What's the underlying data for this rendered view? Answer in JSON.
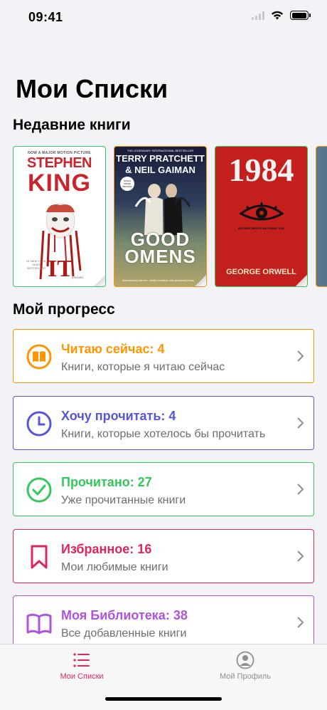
{
  "status_bar": {
    "time": "09:41"
  },
  "page_title": "Мои Списки",
  "recent_section_title": "Недавние книги",
  "books": [
    {
      "border_color": "#34c759",
      "cover_tagline": "NOW A MAJOR MOTION PICTURE",
      "author_line1": "STEPHEN",
      "author_line2": "KING",
      "blurb": "#1 NEW YORK TIMES BESTSELLER",
      "novel_label": "A NOVEL"
    },
    {
      "border_color": "#ff9500",
      "cover_tagline": "THE LEGENDARY INTERNATIONAL BESTSELLER",
      "author_line1": "TERRY PRATCHETT",
      "author_line2": "& NEIL GAIMAN",
      "badge": "NOW A PRIME ORIGINAL",
      "title": "GOOD OMENS",
      "quote": "Marvellously bizarre, wildly inventive and gloriously funny"
    },
    {
      "border_color": "#34c759",
      "title": "1984",
      "subtitle": "BIG BROTHER IS WATCHING YOU",
      "author": "GEORGE ORWELL"
    },
    {
      "border_color": "#ff9500"
    }
  ],
  "progress_section_title": "Мой прогресс",
  "progress": [
    {
      "title": "Читаю сейчас: 4",
      "subtitle": "Книги, которые я читаю сейчас",
      "color": "#ff9500",
      "icon": "open-book-circle-icon"
    },
    {
      "title": "Хочу прочитать: 4",
      "subtitle": "Книги, которые хотелось бы прочитать",
      "color": "#5856d6",
      "icon": "clock-icon"
    },
    {
      "title": "Прочитано: 27",
      "subtitle": "Уже прочитанные книги",
      "color": "#34c759",
      "icon": "checkmark-circle-icon"
    },
    {
      "title": "Избранное: 16",
      "subtitle": "Мои любимые книги",
      "color": "#e0245e",
      "icon": "bookmark-icon"
    },
    {
      "title": "Моя Библиотека: 38",
      "subtitle": "Все добавленные книги",
      "color": "#af52de",
      "icon": "book-icon"
    }
  ],
  "tabs": [
    {
      "label": "Мои Списки",
      "icon": "list-icon",
      "active": true,
      "color": "#e0245e"
    },
    {
      "label": "Мой Профиль",
      "icon": "profile-icon",
      "active": false,
      "color": "#8e8e93"
    }
  ]
}
